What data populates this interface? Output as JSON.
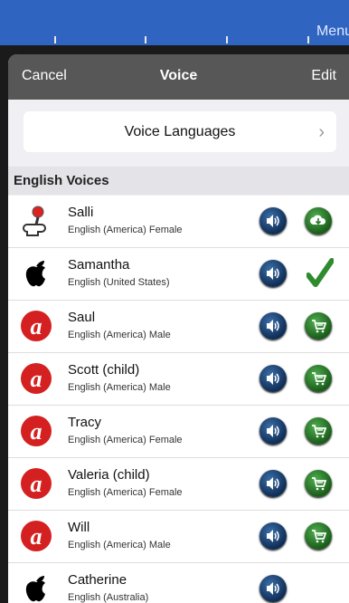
{
  "background": {
    "menu_label": "Menu"
  },
  "navbar": {
    "cancel_label": "Cancel",
    "title": "Voice",
    "edit_label": "Edit"
  },
  "voice_languages": {
    "label": "Voice Languages"
  },
  "section": {
    "title": "English Voices"
  },
  "voices": [
    {
      "name": "Salli",
      "desc": "English (America) Female",
      "logo": "robot-icon",
      "action": "download-icon"
    },
    {
      "name": "Samantha",
      "desc": "English (United States)",
      "logo": "apple-icon",
      "action": "checkmark-icon"
    },
    {
      "name": "Saul",
      "desc": "English (America) Male",
      "logo": "acapela-icon",
      "action": "cart-icon"
    },
    {
      "name": "Scott (child)",
      "desc": "English (America) Male",
      "logo": "acapela-icon",
      "action": "cart-icon"
    },
    {
      "name": "Tracy",
      "desc": "English (America) Female",
      "logo": "acapela-icon",
      "action": "cart-icon"
    },
    {
      "name": "Valeria (child)",
      "desc": "English (America) Female",
      "logo": "acapela-icon",
      "action": "cart-icon"
    },
    {
      "name": "Will",
      "desc": "English (America) Male",
      "logo": "acapela-icon",
      "action": "cart-icon"
    },
    {
      "name": "Catherine",
      "desc": "English (Australia)",
      "logo": "apple-icon",
      "action": "none"
    }
  ],
  "colors": {
    "topbar": "#2f64c0",
    "navbar": "#575757",
    "accent_green": "#2e8b2e",
    "speaker_blue": "#1c3f6e",
    "acapela_red": "#d42020"
  }
}
